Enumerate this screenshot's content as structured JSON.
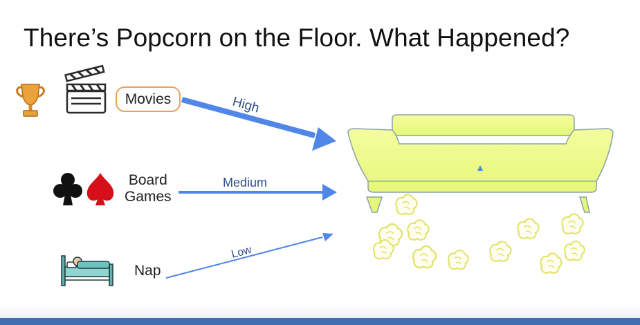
{
  "title": "There’s Popcorn on the Floor. What Happened?",
  "activities": [
    {
      "label": "Movies",
      "icons": [
        "trophy-icon",
        "clapperboard-icon"
      ],
      "level": "High"
    },
    {
      "label_line1": "Board",
      "label_line2": "Games",
      "icons": [
        "clubs-icon",
        "spades-icon"
      ],
      "level": "Medium"
    },
    {
      "label": "Nap",
      "icons": [
        "bed-icon"
      ],
      "level": "Low"
    }
  ],
  "colors": {
    "arrow": "#4f86e8",
    "arrow_text": "#2f4f8f",
    "couch": "#eefc8c",
    "couch_outline": "#8aa0a8",
    "popcorn": "#e4e86a",
    "pill_border": "#e8a25c"
  }
}
